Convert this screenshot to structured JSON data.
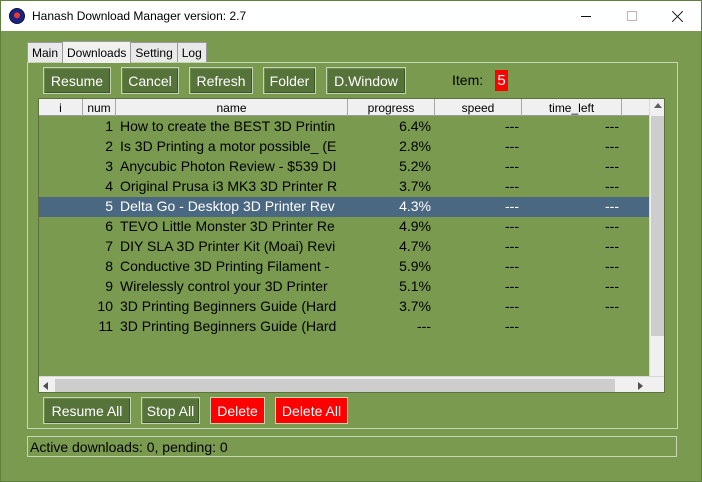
{
  "window": {
    "title": "Hanash Download Manager version: 2.7",
    "icon": "hanash-app-icon"
  },
  "tabs": [
    {
      "label": "Main",
      "active": false
    },
    {
      "label": "Downloads",
      "active": true
    },
    {
      "label": "Setting",
      "active": false
    },
    {
      "label": "Log",
      "active": false
    }
  ],
  "toolbar": {
    "resume": "Resume",
    "cancel": "Cancel",
    "refresh": "Refresh",
    "folder": "Folder",
    "dwindow": "D.Window",
    "item_label": "Item:",
    "item_value": "5"
  },
  "table": {
    "columns": [
      "i",
      "num",
      "name",
      "progress",
      "speed",
      "time_left"
    ],
    "rows": [
      {
        "num": "1",
        "name": "How to create the BEST 3D Printin",
        "progress": "6.4%",
        "speed": "---",
        "time_left": "---",
        "selected": false
      },
      {
        "num": "2",
        "name": "Is 3D Printing a motor possible_ (E",
        "progress": "2.8%",
        "speed": "---",
        "time_left": "---",
        "selected": false
      },
      {
        "num": "3",
        "name": "Anycubic Photon Review - $539 DI",
        "progress": "5.2%",
        "speed": "---",
        "time_left": "---",
        "selected": false
      },
      {
        "num": "4",
        "name": "Original Prusa i3 MK3 3D Printer R",
        "progress": "3.7%",
        "speed": "---",
        "time_left": "---",
        "selected": false
      },
      {
        "num": "5",
        "name": "Delta Go - Desktop 3D Printer Rev",
        "progress": "4.3%",
        "speed": "---",
        "time_left": "---",
        "selected": true
      },
      {
        "num": "6",
        "name": "TEVO Little Monster 3D Printer Re",
        "progress": "4.9%",
        "speed": "---",
        "time_left": "---",
        "selected": false
      },
      {
        "num": "7",
        "name": "DIY SLA 3D Printer Kit (Moai) Revi",
        "progress": "4.7%",
        "speed": "---",
        "time_left": "---",
        "selected": false
      },
      {
        "num": "8",
        "name": "Conductive 3D Printing Filament -",
        "progress": "5.9%",
        "speed": "---",
        "time_left": "---",
        "selected": false
      },
      {
        "num": "9",
        "name": "Wirelessly control your 3D Printer",
        "progress": "5.1%",
        "speed": "---",
        "time_left": "---",
        "selected": false
      },
      {
        "num": "10",
        "name": "3D Printing Beginners Guide (Hard",
        "progress": "3.7%",
        "speed": "---",
        "time_left": "---",
        "selected": false
      },
      {
        "num": "11",
        "name": "3D Printing Beginners Guide (Hard",
        "progress": "---",
        "speed": "---",
        "time_left": "",
        "selected": false
      }
    ]
  },
  "bottom_buttons": {
    "resume_all": "Resume All",
    "stop_all": "Stop All",
    "delete": "Delete",
    "delete_all": "Delete All"
  },
  "status": {
    "text": "Active downloads: 0, pending: 0"
  },
  "colors": {
    "background": "#7a9a4f",
    "button_green": "#56733a",
    "button_red": "#ff0000",
    "selected_row": "#4a6882"
  }
}
